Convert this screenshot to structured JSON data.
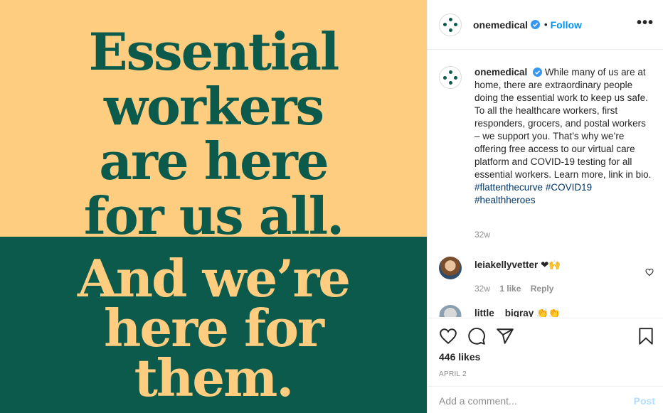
{
  "post_image": {
    "top_lines": [
      "Essential",
      "workers",
      "are here",
      "for us all."
    ],
    "bottom_lines": [
      "And we’re",
      "here for",
      "them."
    ],
    "colors": {
      "gold": "#fecd80",
      "green": "#0b5a4c"
    }
  },
  "header": {
    "username": "onemedical",
    "follow_label": "Follow",
    "more_icon": "more-horizontal-icon"
  },
  "caption": {
    "username": "onemedical",
    "text": "While many of us are at home, there are extraordinary people doing the essential work to keep us safe. To all the healthcare workers, first responders, grocers, and postal workers – we support you. That’s why we’re offering free access to our virtual care platform and COVID-19 testing for all essential workers. Learn more, link in bio.",
    "hashtags": [
      "#flattenthecurve",
      "#COVID19",
      "#healthheroes"
    ],
    "time": "32w"
  },
  "comments": [
    {
      "username": "leiakellyvetter",
      "text": "❤🙌",
      "time": "32w",
      "likes": "1 like",
      "reply_label": "Reply"
    },
    {
      "username": "little__bigray",
      "text": "👏👏",
      "time": "",
      "likes": "",
      "reply_label": ""
    }
  ],
  "actions": {
    "icons": [
      "heart-icon",
      "comment-icon",
      "share-icon",
      "bookmark-icon"
    ],
    "likes": "446 likes",
    "date": "APRIL 2"
  },
  "add_comment": {
    "placeholder": "Add a comment...",
    "post_label": "Post"
  }
}
